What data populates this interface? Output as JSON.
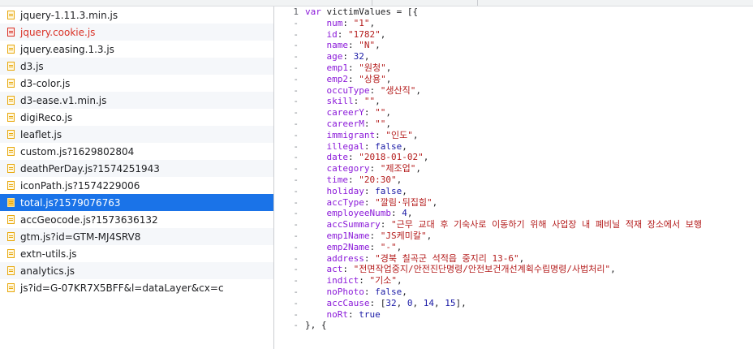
{
  "files": [
    {
      "name": "jquery-1.11.3.min.js",
      "variant": "normal"
    },
    {
      "name": "jquery.cookie.js",
      "variant": "cookie"
    },
    {
      "name": "jquery.easing.1.3.js",
      "variant": "normal"
    },
    {
      "name": "d3.js",
      "variant": "normal"
    },
    {
      "name": "d3-color.js",
      "variant": "normal"
    },
    {
      "name": "d3-ease.v1.min.js",
      "variant": "normal"
    },
    {
      "name": "digiReco.js",
      "variant": "normal"
    },
    {
      "name": "leaflet.js",
      "variant": "normal"
    },
    {
      "name": "custom.js?1629802804",
      "variant": "normal"
    },
    {
      "name": "deathPerDay.js?1574251943",
      "variant": "normal"
    },
    {
      "name": "iconPath.js?1574229006",
      "variant": "normal"
    },
    {
      "name": "total.js?1579076763",
      "variant": "selected"
    },
    {
      "name": "accGeocode.js?1573636132",
      "variant": "normal"
    },
    {
      "name": "gtm.js?id=GTM-MJ4SRV8",
      "variant": "normal"
    },
    {
      "name": "extn-utils.js",
      "variant": "normal"
    },
    {
      "name": "analytics.js",
      "variant": "normal"
    },
    {
      "name": "js?id=G-07KR7X5BFF&l=dataLayer&cx=c",
      "variant": "normal"
    }
  ],
  "code_lines": [
    {
      "gutter": "1",
      "tokens": [
        {
          "t": "var ",
          "c": "k"
        },
        {
          "t": "victimValues = [{",
          "c": ""
        }
      ]
    },
    {
      "gutter": "-",
      "tokens": [
        {
          "t": "    num",
          "c": "p"
        },
        {
          "t": ": ",
          "c": ""
        },
        {
          "t": "\"1\"",
          "c": "s"
        },
        {
          "t": ",",
          "c": ""
        }
      ]
    },
    {
      "gutter": "-",
      "tokens": [
        {
          "t": "    id",
          "c": "p"
        },
        {
          "t": ": ",
          "c": ""
        },
        {
          "t": "\"1782\"",
          "c": "s"
        },
        {
          "t": ",",
          "c": ""
        }
      ]
    },
    {
      "gutter": "-",
      "tokens": [
        {
          "t": "    name",
          "c": "p"
        },
        {
          "t": ": ",
          "c": ""
        },
        {
          "t": "\"N\"",
          "c": "s"
        },
        {
          "t": ",",
          "c": ""
        }
      ]
    },
    {
      "gutter": "-",
      "tokens": [
        {
          "t": "    age",
          "c": "p"
        },
        {
          "t": ": ",
          "c": ""
        },
        {
          "t": "32",
          "c": "n"
        },
        {
          "t": ",",
          "c": ""
        }
      ]
    },
    {
      "gutter": "-",
      "tokens": [
        {
          "t": "    emp1",
          "c": "p"
        },
        {
          "t": ": ",
          "c": ""
        },
        {
          "t": "\"원청\"",
          "c": "s"
        },
        {
          "t": ",",
          "c": ""
        }
      ]
    },
    {
      "gutter": "-",
      "tokens": [
        {
          "t": "    emp2",
          "c": "p"
        },
        {
          "t": ": ",
          "c": ""
        },
        {
          "t": "\"상용\"",
          "c": "s"
        },
        {
          "t": ",",
          "c": ""
        }
      ]
    },
    {
      "gutter": "-",
      "tokens": [
        {
          "t": "    occuType",
          "c": "p"
        },
        {
          "t": ": ",
          "c": ""
        },
        {
          "t": "\"생산직\"",
          "c": "s"
        },
        {
          "t": ",",
          "c": ""
        }
      ]
    },
    {
      "gutter": "-",
      "tokens": [
        {
          "t": "    skill",
          "c": "p"
        },
        {
          "t": ": ",
          "c": ""
        },
        {
          "t": "\"\"",
          "c": "s"
        },
        {
          "t": ",",
          "c": ""
        }
      ]
    },
    {
      "gutter": "-",
      "tokens": [
        {
          "t": "    careerY",
          "c": "p"
        },
        {
          "t": ": ",
          "c": ""
        },
        {
          "t": "\"\"",
          "c": "s"
        },
        {
          "t": ",",
          "c": ""
        }
      ]
    },
    {
      "gutter": "-",
      "tokens": [
        {
          "t": "    careerM",
          "c": "p"
        },
        {
          "t": ": ",
          "c": ""
        },
        {
          "t": "\"\"",
          "c": "s"
        },
        {
          "t": ",",
          "c": ""
        }
      ]
    },
    {
      "gutter": "-",
      "tokens": [
        {
          "t": "    immigrant",
          "c": "p"
        },
        {
          "t": ": ",
          "c": ""
        },
        {
          "t": "\"인도\"",
          "c": "s"
        },
        {
          "t": ",",
          "c": ""
        }
      ]
    },
    {
      "gutter": "-",
      "tokens": [
        {
          "t": "    illegal",
          "c": "p"
        },
        {
          "t": ": ",
          "c": ""
        },
        {
          "t": "false",
          "c": "b"
        },
        {
          "t": ",",
          "c": ""
        }
      ]
    },
    {
      "gutter": "-",
      "tokens": [
        {
          "t": "    date",
          "c": "p"
        },
        {
          "t": ": ",
          "c": ""
        },
        {
          "t": "\"2018-01-02\"",
          "c": "s"
        },
        {
          "t": ",",
          "c": ""
        }
      ]
    },
    {
      "gutter": "-",
      "tokens": [
        {
          "t": "    category",
          "c": "p"
        },
        {
          "t": ": ",
          "c": ""
        },
        {
          "t": "\"제조업\"",
          "c": "s"
        },
        {
          "t": ",",
          "c": ""
        }
      ]
    },
    {
      "gutter": "-",
      "tokens": [
        {
          "t": "    time",
          "c": "p"
        },
        {
          "t": ": ",
          "c": ""
        },
        {
          "t": "\"20:30\"",
          "c": "s"
        },
        {
          "t": ",",
          "c": ""
        }
      ]
    },
    {
      "gutter": "-",
      "tokens": [
        {
          "t": "    holiday",
          "c": "p"
        },
        {
          "t": ": ",
          "c": ""
        },
        {
          "t": "false",
          "c": "b"
        },
        {
          "t": ",",
          "c": ""
        }
      ]
    },
    {
      "gutter": "-",
      "tokens": [
        {
          "t": "    accType",
          "c": "p"
        },
        {
          "t": ": ",
          "c": ""
        },
        {
          "t": "\"깔림·뒤집힘\"",
          "c": "s"
        },
        {
          "t": ",",
          "c": ""
        }
      ]
    },
    {
      "gutter": "-",
      "tokens": [
        {
          "t": "    employeeNumb",
          "c": "p"
        },
        {
          "t": ": ",
          "c": ""
        },
        {
          "t": "4",
          "c": "n"
        },
        {
          "t": ",",
          "c": ""
        }
      ]
    },
    {
      "gutter": "-",
      "tokens": [
        {
          "t": "    accSummary",
          "c": "p"
        },
        {
          "t": ": ",
          "c": ""
        },
        {
          "t": "\"근무 교대 후 기숙사로 이동하기 위해 사업장 내 폐비닐 적재 장소에서 보행",
          "c": "s"
        }
      ]
    },
    {
      "gutter": "-",
      "tokens": [
        {
          "t": "    emp1Name",
          "c": "p"
        },
        {
          "t": ": ",
          "c": ""
        },
        {
          "t": "\"JS케미칼\"",
          "c": "s"
        },
        {
          "t": ",",
          "c": ""
        }
      ]
    },
    {
      "gutter": "-",
      "tokens": [
        {
          "t": "    emp2Name",
          "c": "p"
        },
        {
          "t": ": ",
          "c": ""
        },
        {
          "t": "\"-\"",
          "c": "s"
        },
        {
          "t": ",",
          "c": ""
        }
      ]
    },
    {
      "gutter": "-",
      "tokens": [
        {
          "t": "    address",
          "c": "p"
        },
        {
          "t": ": ",
          "c": ""
        },
        {
          "t": "\"경북 칠곡군 석적읍 중지리 13-6\"",
          "c": "s"
        },
        {
          "t": ",",
          "c": ""
        }
      ]
    },
    {
      "gutter": "-",
      "tokens": [
        {
          "t": "    act",
          "c": "p"
        },
        {
          "t": ": ",
          "c": ""
        },
        {
          "t": "\"전면작업중지/안전진단명령/안전보건개선계획수립명령/사법처리\"",
          "c": "s"
        },
        {
          "t": ",",
          "c": ""
        }
      ]
    },
    {
      "gutter": "-",
      "tokens": [
        {
          "t": "    indict",
          "c": "p"
        },
        {
          "t": ": ",
          "c": ""
        },
        {
          "t": "\"기소\"",
          "c": "s"
        },
        {
          "t": ",",
          "c": ""
        }
      ]
    },
    {
      "gutter": "-",
      "tokens": [
        {
          "t": "    noPhoto",
          "c": "p"
        },
        {
          "t": ": ",
          "c": ""
        },
        {
          "t": "false",
          "c": "b"
        },
        {
          "t": ",",
          "c": ""
        }
      ]
    },
    {
      "gutter": "-",
      "tokens": [
        {
          "t": "    accCause",
          "c": "p"
        },
        {
          "t": ": [",
          "c": ""
        },
        {
          "t": "32",
          "c": "n"
        },
        {
          "t": ", ",
          "c": ""
        },
        {
          "t": "0",
          "c": "n"
        },
        {
          "t": ", ",
          "c": ""
        },
        {
          "t": "14",
          "c": "n"
        },
        {
          "t": ", ",
          "c": ""
        },
        {
          "t": "15",
          "c": "n"
        },
        {
          "t": "],",
          "c": ""
        }
      ]
    },
    {
      "gutter": "-",
      "tokens": [
        {
          "t": "    noRt",
          "c": "p"
        },
        {
          "t": ": ",
          "c": ""
        },
        {
          "t": "true",
          "c": "b"
        }
      ]
    },
    {
      "gutter": "-",
      "tokens": [
        {
          "t": "}, {",
          "c": ""
        }
      ]
    }
  ]
}
